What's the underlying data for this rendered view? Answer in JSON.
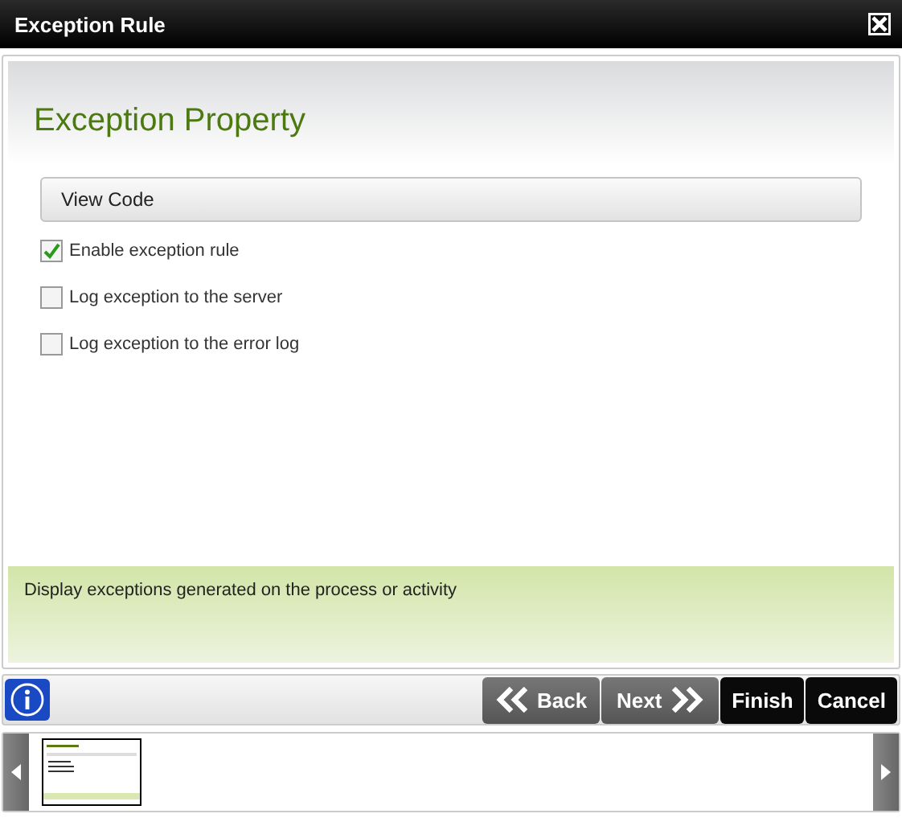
{
  "window": {
    "title": "Exception Rule"
  },
  "header": {
    "title": "Exception Property"
  },
  "section": {
    "label": "View Code"
  },
  "options": [
    {
      "label": "Enable exception rule",
      "checked": true
    },
    {
      "label": "Log exception to the server",
      "checked": false
    },
    {
      "label": "Log exception to the error log",
      "checked": false
    }
  ],
  "help": {
    "text": "Display exceptions generated on the process or activity"
  },
  "buttons": [
    {
      "label": "Back",
      "kind": "back"
    },
    {
      "label": "Next",
      "kind": "next"
    },
    {
      "label": "Finish",
      "kind": "primary"
    },
    {
      "label": "Cancel",
      "kind": "primary"
    }
  ],
  "thumbnails": [
    {
      "selected": true
    }
  ]
}
